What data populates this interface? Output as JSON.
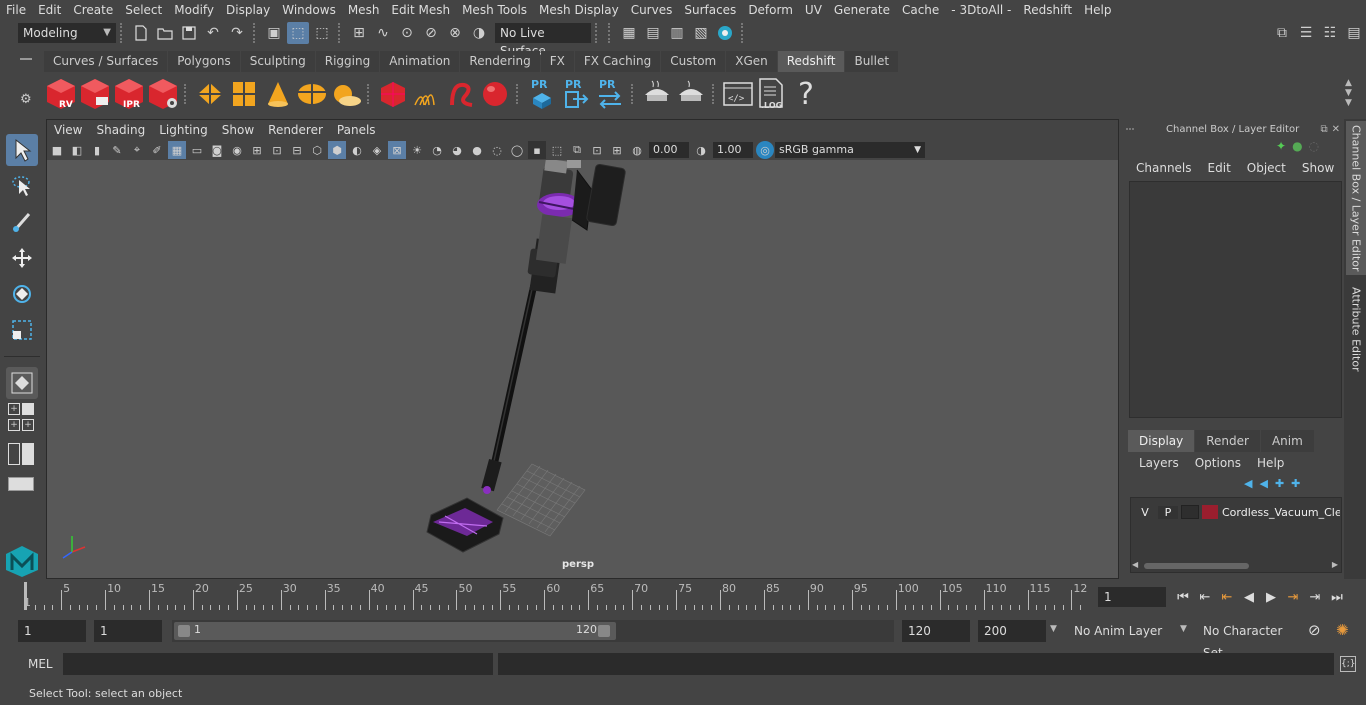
{
  "menubar": {
    "items": [
      "File",
      "Edit",
      "Create",
      "Select",
      "Modify",
      "Display",
      "Windows",
      "Mesh",
      "Edit Mesh",
      "Mesh Tools",
      "Mesh Display",
      "Curves",
      "Surfaces",
      "Deform",
      "UV",
      "Generate",
      "Cache",
      "- 3DtoAll -",
      "Redshift",
      "Help"
    ]
  },
  "statusline": {
    "menuset": "Modeling",
    "live_surface": "No Live Surface"
  },
  "shelf": {
    "tabs": [
      "Curves / Surfaces",
      "Polygons",
      "Sculpting",
      "Rigging",
      "Animation",
      "Rendering",
      "FX",
      "FX Caching",
      "Custom",
      "XGen",
      "Redshift",
      "Bullet"
    ],
    "active_tab": "Redshift",
    "labels": {
      "rv": "RV",
      "ipr": "IPR",
      "pr1": "PR",
      "pr2": "PR",
      "pr3": "PR",
      "log": ".LOG",
      "help": "?"
    }
  },
  "viewport": {
    "menu": [
      "View",
      "Shading",
      "Lighting",
      "Show",
      "Renderer",
      "Panels"
    ],
    "exposure": "0.00",
    "gamma": "1.00",
    "colorspace": "sRGB gamma",
    "camera_label": "persp"
  },
  "rightpanel": {
    "title": "Channel Box / Layer Editor",
    "menu": [
      "Channels",
      "Edit",
      "Object",
      "Show"
    ],
    "tabs": [
      "Display",
      "Render",
      "Anim"
    ],
    "active_tab": "Display",
    "layer_menu": [
      "Layers",
      "Options",
      "Help"
    ],
    "layer": {
      "v": "V",
      "p": "P",
      "name": "Cordless_Vacuum_Clea",
      "color": "#9a1e2e"
    },
    "vertical_tabs": [
      "Channel Box / Layer Editor",
      "Attribute Editor"
    ]
  },
  "timeline": {
    "ticks": [
      "5",
      "10",
      "15",
      "20",
      "25",
      "30",
      "35",
      "40",
      "45",
      "50",
      "55",
      "60",
      "65",
      "70",
      "75",
      "80",
      "85",
      "90",
      "95",
      "100",
      "105",
      "110",
      "115",
      "12"
    ],
    "current_marker": "1",
    "current_frame": "1"
  },
  "range": {
    "start": "1",
    "playback_start": "1",
    "slider_start": "1",
    "slider_end": "120",
    "playback_end": "120",
    "end": "200",
    "anim_layer": "No Anim Layer",
    "character_set": "No Character Set"
  },
  "cmdline": {
    "lang": "MEL"
  },
  "helpline": {
    "text": "Select Tool: select an object"
  },
  "colors": {
    "accent": "#5b7fa6",
    "redshift_red": "#d9262e",
    "purple": "#8a2fc0"
  }
}
